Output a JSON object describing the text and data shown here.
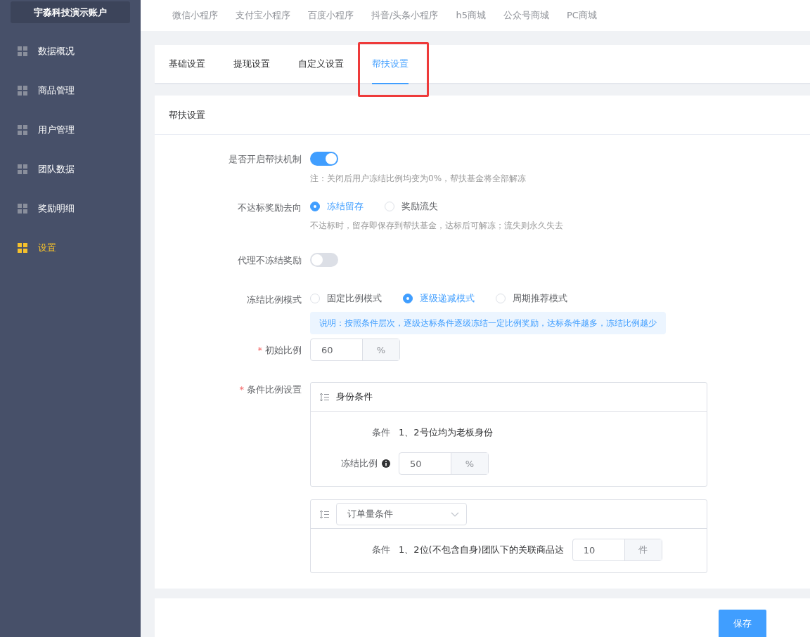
{
  "sidebar": {
    "account": "宇淼科技演示账户",
    "items": [
      {
        "label": "数据概况",
        "selected": false
      },
      {
        "label": "商品管理",
        "selected": false
      },
      {
        "label": "用户管理",
        "selected": false
      },
      {
        "label": "团队数据",
        "selected": false
      },
      {
        "label": "奖励明细",
        "selected": false
      },
      {
        "label": "设置",
        "selected": true
      }
    ]
  },
  "platform_tabs": [
    "微信小程序",
    "支付宝小程序",
    "百度小程序",
    "抖音/头条小程序",
    "h5商城",
    "公众号商城",
    "PC商城"
  ],
  "settings_tabs": [
    {
      "label": "基础设置",
      "selected": false,
      "highlighted": false
    },
    {
      "label": "提现设置",
      "selected": false,
      "highlighted": false
    },
    {
      "label": "自定义设置",
      "selected": false,
      "highlighted": false
    },
    {
      "label": "帮扶设置",
      "selected": true,
      "highlighted": true
    }
  ],
  "panel": {
    "title": "帮扶设置",
    "fields": [
      {
        "kind": "switch",
        "label": "是否开启帮扶机制",
        "on": true,
        "hint": "注：关闭后用户冻结比例均变为0%，帮扶基金将全部解冻"
      },
      {
        "kind": "radio",
        "label": "不达标奖励去向",
        "options": [
          {
            "label": "冻结留存",
            "selected": true
          },
          {
            "label": "奖励流失",
            "selected": false
          }
        ],
        "hint": "不达标时，留存即保存到帮扶基金，达标后可解冻；流失则永久失去"
      },
      {
        "kind": "switch",
        "label": "代理不冻结奖励",
        "on": false
      },
      {
        "kind": "radio",
        "label": "冻结比例模式",
        "options": [
          {
            "label": "固定比例模式",
            "selected": false
          },
          {
            "label": "逐级递减模式",
            "selected": true
          },
          {
            "label": "周期推荐模式",
            "selected": false
          }
        ],
        "note": "说明：按照条件层次，逐级达标条件逐级冻结一定比例奖励，达标条件越多，冻结比例越少"
      },
      {
        "kind": "input",
        "label": "初始比例",
        "required_mark": "*",
        "value": "60",
        "unit": "%"
      },
      {
        "kind": "conditions",
        "label": "条件比例设置",
        "required_mark": "*",
        "cards": [
          {
            "kind": "title",
            "header": "身份条件",
            "rows": [
              {
                "label": "条件",
                "text": "1、2号位均为老板身份"
              },
              {
                "label": "冻结比例",
                "info": true,
                "value": "50",
                "unit": "%"
              }
            ]
          },
          {
            "kind": "select",
            "header": "订单量条件",
            "rows": [
              {
                "label": "条件",
                "text": "1、2位(不包含自身)团队下的关联商品达",
                "value": "10",
                "unit": "件"
              }
            ]
          }
        ]
      }
    ]
  },
  "save_button": "保存"
}
